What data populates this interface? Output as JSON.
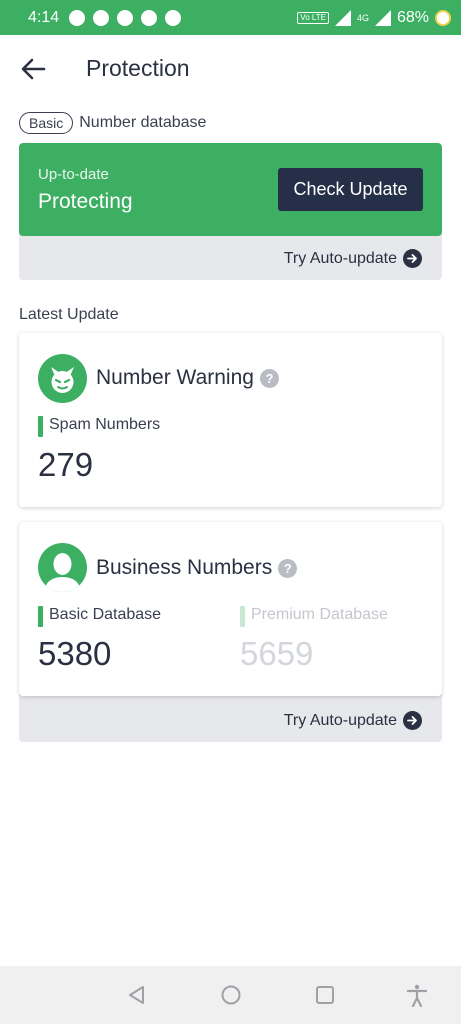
{
  "status_bar": {
    "time": "4:14",
    "network_badge": "Vo LTE",
    "network_type": "4G",
    "battery": "68%"
  },
  "header": {
    "title": "Protection"
  },
  "database": {
    "tier_badge": "Basic",
    "section_label": "Number database",
    "status_sub": "Up-to-date",
    "status_main": "Protecting",
    "check_button": "Check Update",
    "auto_update": "Try Auto-update"
  },
  "latest_update": {
    "label": "Latest Update",
    "number_warning": {
      "title": "Number Warning",
      "stat_label": "Spam Numbers",
      "stat_value": "279"
    },
    "business_numbers": {
      "title": "Business Numbers",
      "basic_label": "Basic Database",
      "basic_value": "5380",
      "premium_label": "Premium Database",
      "premium_value": "5659",
      "auto_update": "Try Auto-update"
    }
  },
  "icons": {
    "back": "arrow-left-icon",
    "help": "question-circle-icon",
    "auto_update": "arrow-right-circle-icon",
    "warning_avatar": "devil-face-icon",
    "business_avatar": "person-silhouette-icon"
  },
  "colors": {
    "accent_green": "#3caf62",
    "dark_button": "#253048",
    "text": "#2b3142"
  }
}
